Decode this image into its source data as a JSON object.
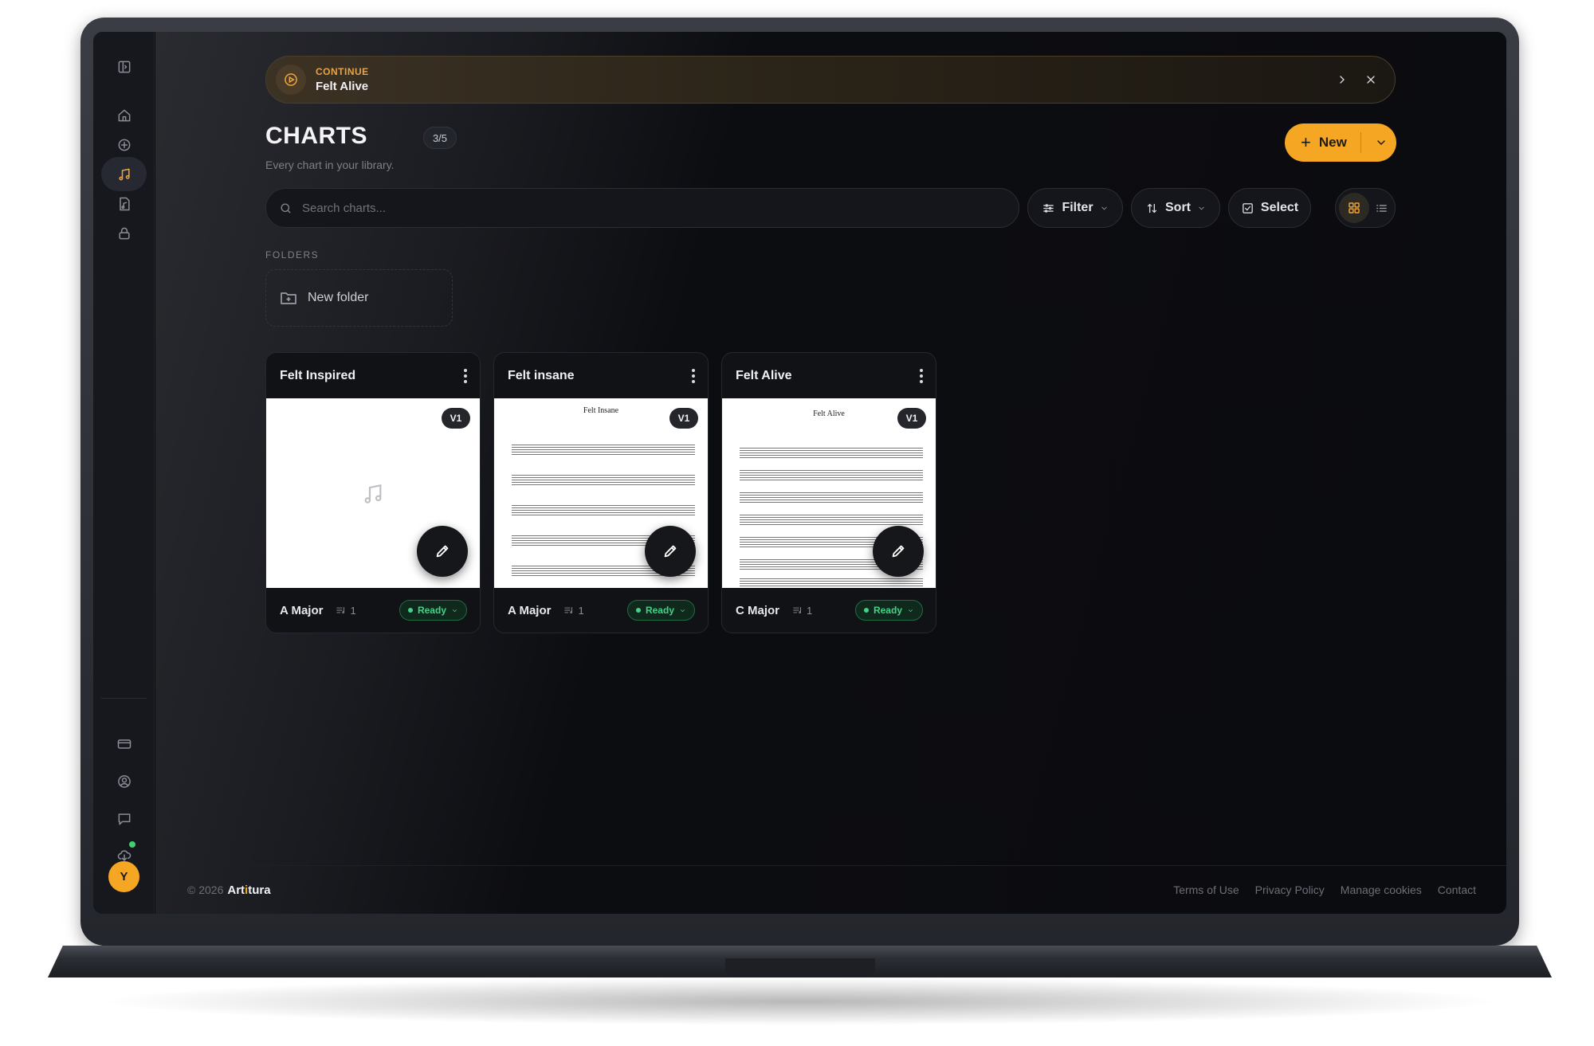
{
  "continue": {
    "label": "CONTINUE",
    "title": "Felt Alive"
  },
  "page": {
    "title": "CHARTS",
    "count": "3/5",
    "subtitle": "Every chart in your library."
  },
  "toolbar": {
    "new_label": "New",
    "search_placeholder": "Search charts...",
    "filter_label": "Filter",
    "sort_label": "Sort",
    "select_label": "Select"
  },
  "folders": {
    "section_label": "FOLDERS",
    "new_folder_label": "New folder"
  },
  "charts": [
    {
      "title": "Felt Inspired",
      "version": "V1",
      "key": "A Major",
      "parts": "1",
      "status": "Ready",
      "preview": "empty"
    },
    {
      "title": "Felt insane",
      "version": "V1",
      "key": "A Major",
      "parts": "1",
      "status": "Ready",
      "preview": "sheet",
      "sheet_title": "Felt Insane"
    },
    {
      "title": "Felt Alive",
      "version": "V1",
      "key": "C Major",
      "parts": "1",
      "status": "Ready",
      "preview": "sheet",
      "sheet_title": "Felt Alive"
    }
  ],
  "user": {
    "avatar_initial": "Y"
  },
  "footer": {
    "copyright": "© 2026",
    "brand_pre": "Art",
    "brand_accent": "i",
    "brand_post": "tura",
    "links": [
      "Terms of Use",
      "Privacy Policy",
      "Manage cookies",
      "Contact"
    ]
  },
  "colors": {
    "accent": "#f5a623",
    "status_ready": "#45d18a",
    "background": "#0b0c10"
  }
}
